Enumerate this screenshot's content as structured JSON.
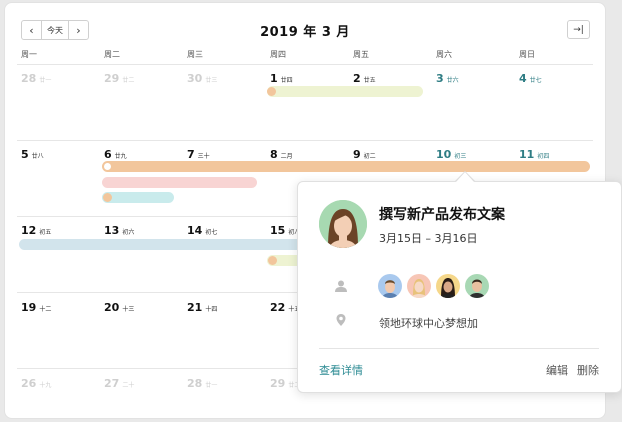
{
  "header": {
    "prev_label": "‹",
    "today_label": "今天",
    "next_label": "›",
    "title": "2019 年 3 月",
    "collapse_label": "→|"
  },
  "weekdays": [
    "周一",
    "周二",
    "周三",
    "周四",
    "周五",
    "周六",
    "周日"
  ],
  "weeks": [
    [
      {
        "n": "28",
        "l": "廿一",
        "muted": true
      },
      {
        "n": "29",
        "l": "廿二",
        "muted": true
      },
      {
        "n": "30",
        "l": "廿三",
        "muted": true
      },
      {
        "n": "1",
        "l": "廿四"
      },
      {
        "n": "2",
        "l": "廿五"
      },
      {
        "n": "3",
        "l": "廿六",
        "weekend": true
      },
      {
        "n": "4",
        "l": "廿七",
        "weekend": true
      }
    ],
    [
      {
        "n": "5",
        "l": "廿八"
      },
      {
        "n": "6",
        "l": "廿九"
      },
      {
        "n": "7",
        "l": "三十"
      },
      {
        "n": "8",
        "l": "二月"
      },
      {
        "n": "9",
        "l": "初二"
      },
      {
        "n": "10",
        "l": "初三",
        "weekend": true
      },
      {
        "n": "11",
        "l": "初四",
        "weekend": true
      }
    ],
    [
      {
        "n": "12",
        "l": "初五"
      },
      {
        "n": "13",
        "l": "初六"
      },
      {
        "n": "14",
        "l": "初七"
      },
      {
        "n": "15",
        "l": "初八"
      }
    ],
    [
      {
        "n": "19",
        "l": "十二"
      },
      {
        "n": "20",
        "l": "十三"
      },
      {
        "n": "21",
        "l": "十四"
      },
      {
        "n": "22",
        "l": "十五"
      }
    ],
    [
      {
        "n": "26",
        "l": "十九",
        "muted": true
      },
      {
        "n": "27",
        "l": "二十",
        "muted": true
      },
      {
        "n": "28",
        "l": "廿一",
        "muted": true
      },
      {
        "n": "29",
        "l": "廿二",
        "muted": true
      }
    ]
  ],
  "colors": {
    "green_event": "#eef3d2",
    "orange_event": "#f2c69c",
    "pink_event": "#f8d4d3",
    "teal_event": "#c9ebec",
    "blue_event": "#d2e4ec",
    "accent": "#2b8a93"
  },
  "popup": {
    "title": "撰写新产品发布文案",
    "date_range": "3月15日 – 3月16日",
    "location": "领地环球中心梦想加",
    "detail_link": "查看详情",
    "edit_label": "编辑",
    "delete_label": "删除",
    "person_icon": "person-icon",
    "location_icon": "location-pin-icon"
  }
}
